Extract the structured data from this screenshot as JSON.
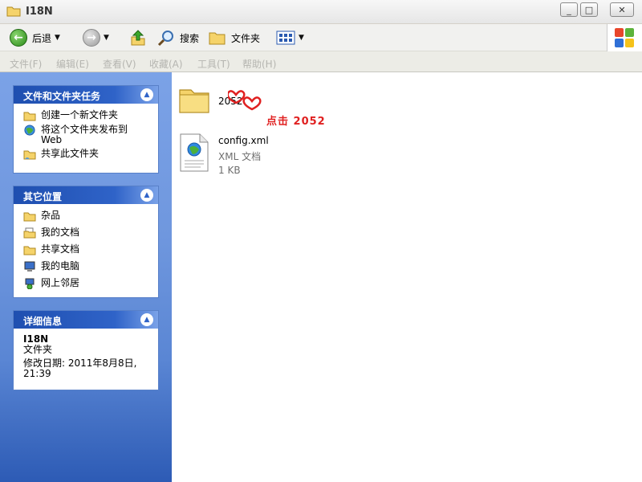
{
  "window": {
    "title": "I18N",
    "minimize": "_",
    "maximize": "□",
    "close": "✕"
  },
  "toolbar": {
    "back_label": "后退",
    "search_label": "搜索",
    "folders_label": "文件夹"
  },
  "menu": [
    "文件(F)",
    "编辑(E)",
    "查看(V)",
    "收藏(A)",
    "工具(T)",
    "帮助(H)"
  ],
  "tasks_panel": {
    "title": "文件和文件夹任务",
    "items": [
      {
        "label": "创建一个新文件夹",
        "icon": "new-folder-icon"
      },
      {
        "label": "将这个文件夹发布到",
        "label2": "Web",
        "icon": "publish-web-icon"
      },
      {
        "label": "共享此文件夹",
        "icon": "share-folder-icon"
      }
    ]
  },
  "other_panel": {
    "title": "其它位置",
    "items": [
      {
        "label": "杂品",
        "icon": "folder-icon"
      },
      {
        "label": "我的文档",
        "icon": "my-documents-icon"
      },
      {
        "label": "共享文档",
        "icon": "folder-icon"
      },
      {
        "label": "我的电脑",
        "icon": "my-computer-icon"
      },
      {
        "label": "网上邻居",
        "icon": "network-places-icon"
      }
    ]
  },
  "details_panel": {
    "title": "详细信息",
    "name": "I18N",
    "type": "文件夹",
    "modified_line1": "修改日期: 2011年8月8日,",
    "modified_line2": "21:39"
  },
  "files": [
    {
      "name": "2052",
      "kind": "folder"
    },
    {
      "name": "config.xml",
      "type": "XML 文档",
      "size": "1 KB",
      "kind": "xml"
    }
  ],
  "annotation": "点击 2052",
  "colors": {
    "panel_head": "#2f63c8",
    "left_pane": "#6f97de",
    "annotation": "#e02020"
  }
}
